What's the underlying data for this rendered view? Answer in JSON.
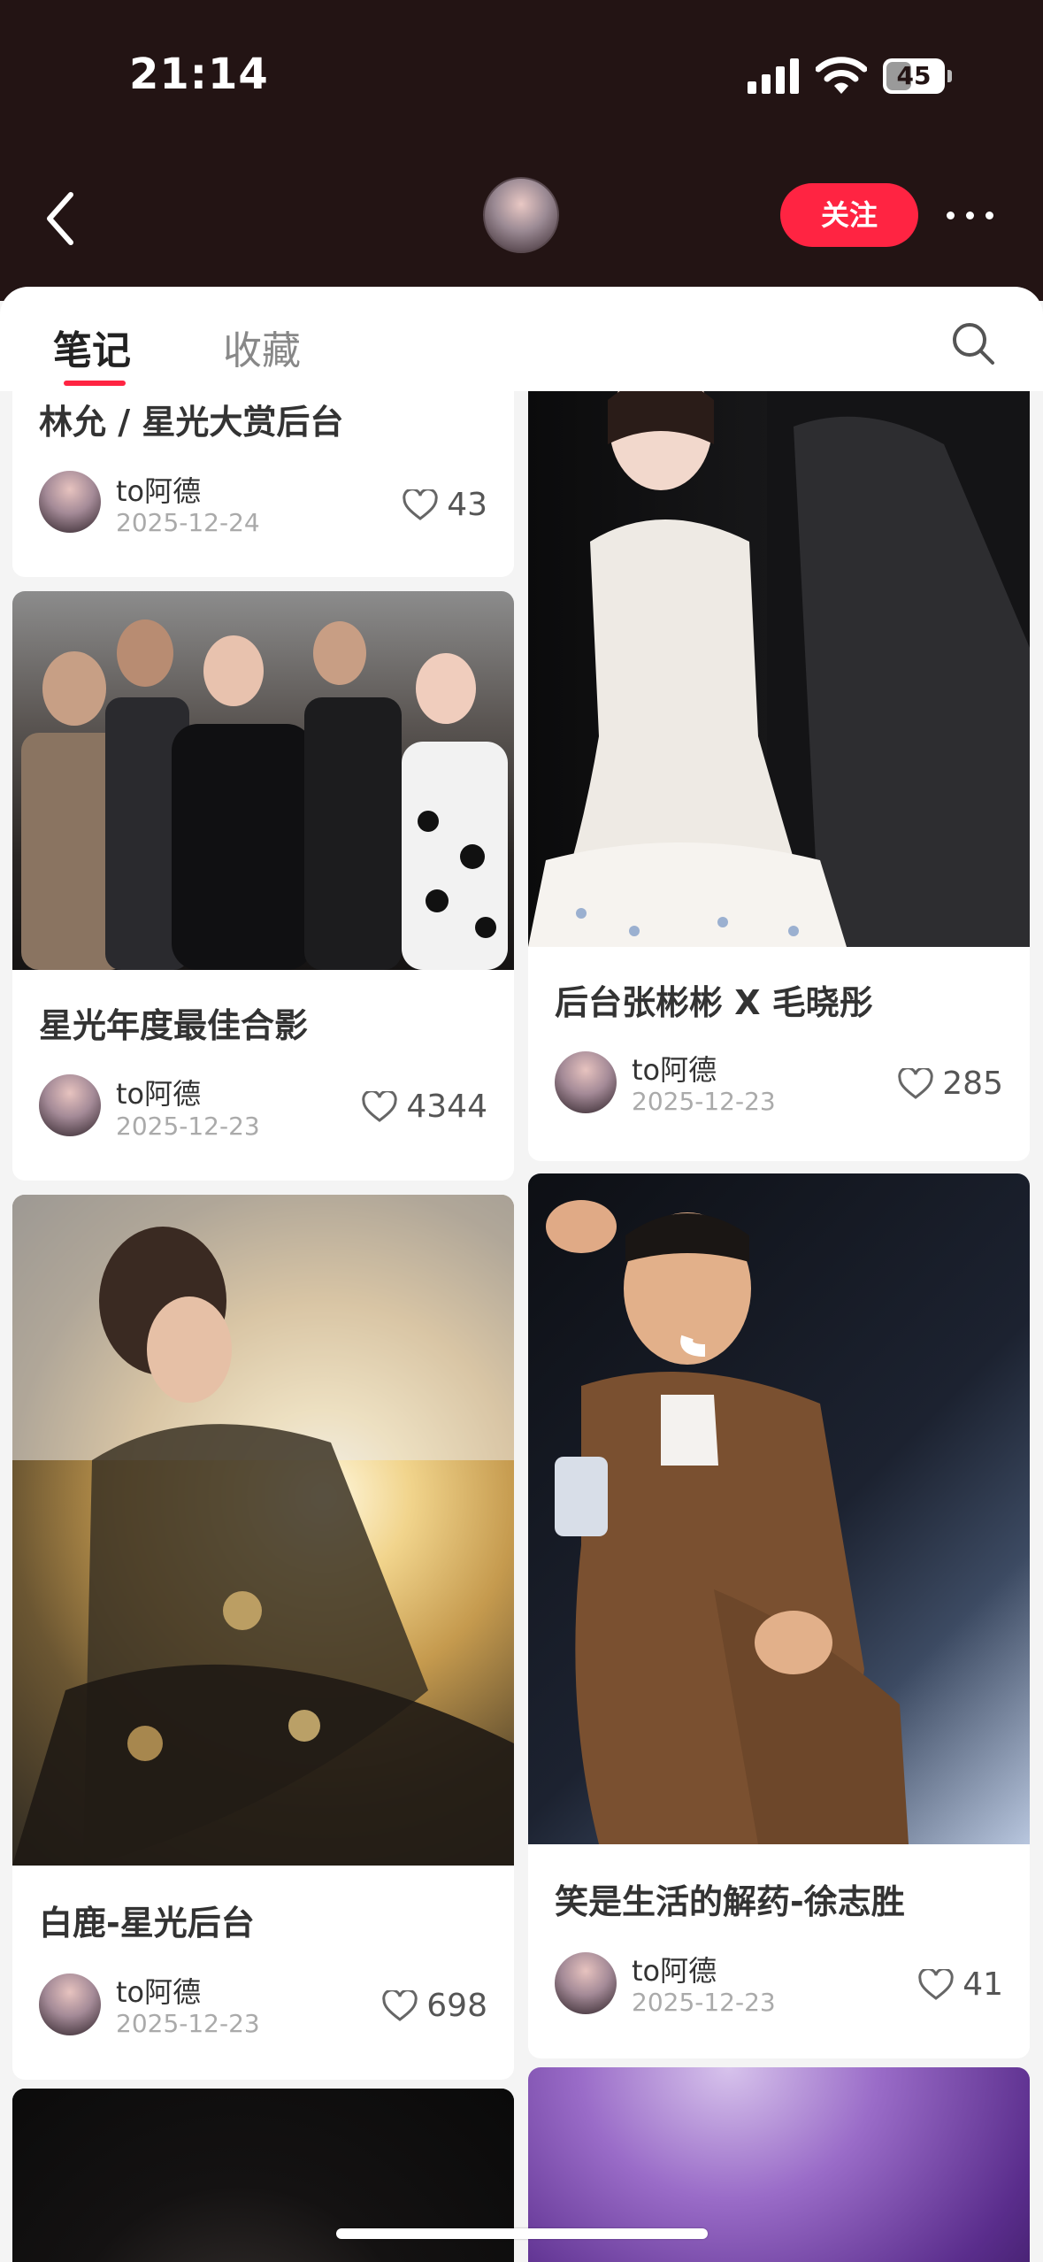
{
  "status_bar": {
    "time": "21:14",
    "battery": "45",
    "battery_level": 0.45
  },
  "header": {
    "follow_label": "关注",
    "icons": [
      "back-icon",
      "more-icon"
    ]
  },
  "tabs": [
    {
      "label": "笔记",
      "active": true
    },
    {
      "label": "收藏",
      "active": false
    }
  ],
  "search_icon": "search-icon",
  "feed": {
    "left": [
      {
        "title": "林允 / 星光大赏后台",
        "author": "to阿德",
        "date": "2025-12-24",
        "likes": "43"
      },
      {
        "title": "星光年度最佳合影",
        "author": "to阿德",
        "date": "2025-12-23",
        "likes": "4344"
      },
      {
        "title": "白鹿-星光后台",
        "author": "to阿德",
        "date": "2025-12-23",
        "likes": "698"
      }
    ],
    "right": [
      {
        "title": "后台张彬彬 X 毛晓彤",
        "author": "to阿德",
        "date": "2025-12-23",
        "likes": "285"
      },
      {
        "title": "笑是生活的解药-徐志胜",
        "author": "to阿德",
        "date": "2025-12-23",
        "likes": "41"
      }
    ]
  },
  "colors": {
    "accent": "#ff2442",
    "header_bg": "#231414"
  }
}
